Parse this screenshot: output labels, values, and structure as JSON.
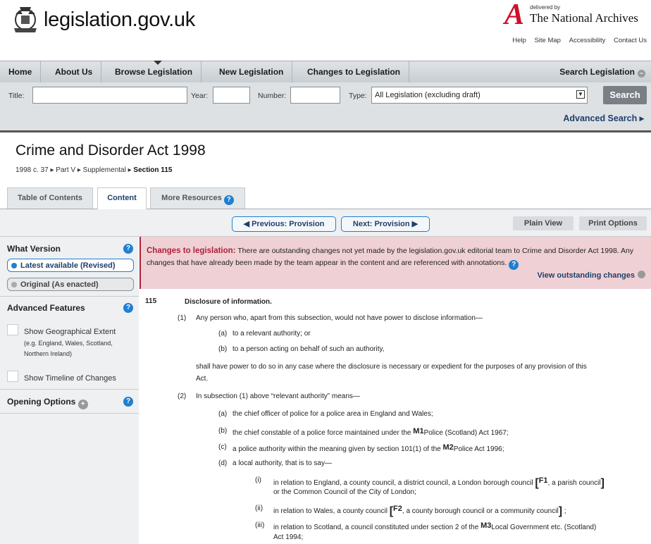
{
  "header": {
    "site_title": "legislation.gov.uk",
    "tna_delivered_by": "delivered by",
    "tna_name": "The National Archives",
    "top_links": [
      "Help",
      "Site Map",
      "Accessibility",
      "Contact Us"
    ]
  },
  "nav": {
    "items": [
      "Home",
      "About Us",
      "Browse Legislation",
      "New Legislation",
      "Changes to Legislation"
    ],
    "search_legislation": "Search Legislation"
  },
  "search": {
    "title_label": "Title:",
    "title_value": "",
    "year_label": "Year:",
    "year_value": "",
    "number_label": "Number:",
    "number_value": "",
    "type_label": "Type:",
    "type_value": "All Legislation (excluding draft)",
    "button": "Search",
    "advanced": "Advanced Search ▸"
  },
  "page": {
    "title": "Crime and Disorder Act 1998",
    "breadcrumb": [
      "1998 c. 37 ▸",
      "Part V ▸",
      "Supplemental ▸",
      "Section 115"
    ]
  },
  "tabs": [
    "Table of Contents",
    "Content",
    "More Resources"
  ],
  "provision_bar": {
    "previous": "◀ Previous: Provision",
    "next": "Next: Provision ▶",
    "plain_view": "Plain View",
    "print_options": "Print Options"
  },
  "sidebar": {
    "what_version": "What Version",
    "latest": "Latest available (Revised)",
    "original": "Original (As enacted)",
    "advanced_features": "Advanced Features",
    "show_geo": "Show Geographical Extent",
    "show_geo_sub": "(e.g. England, Wales, Scotland, Northern Ireland)",
    "show_timeline": "Show Timeline of Changes",
    "opening_options": "Opening Options"
  },
  "changes": {
    "label": "Changes to legislation:",
    "text": "There are outstanding changes not yet made by the legislation.gov.uk editorial team to Crime and Disorder Act 1998. Any changes that have already been made by the team appear in the content and are referenced with annotations.",
    "view_outstanding": "View outstanding changes"
  },
  "section": {
    "number": "115",
    "heading": "Disclosure of information.",
    "s1_num": "(1)",
    "s1_text": "Any person who, apart from this subsection, would not have power to disclose information—",
    "s1_a_num": "(a)",
    "s1_a": "to a relevant authority; or",
    "s1_b_num": "(b)",
    "s1_b": "to a person acting on behalf of such an authority,",
    "s1_tail_1": "shall have power to do so in any case where the disclosure is necessary or expedient for the purposes of any provision of this",
    "s1_tail_2": "Act.",
    "s2_num": "(2)",
    "s2_text": "In subsection (1) above “relevant authority” means—",
    "s2_a_num": "(a)",
    "s2_a": "the chief officer of police for a police area in England and Wales;",
    "s2_b_num": "(b)",
    "s2_b_pre": "the chief constable of a police force maintained under the",
    "s2_b_m": "M1",
    "s2_b_post": "Police (Scotland) Act 1967;",
    "s2_c_num": "(c)",
    "s2_c_pre": "a police authority within the meaning given by section 101(1) of the",
    "s2_c_m": "M2",
    "s2_c_post": "Police Act 1996;",
    "s2_d_num": "(d)",
    "s2_d": "a local authority, that is to say—",
    "i_num": "(i)",
    "i_pre": "in relation to England, a county council, a district council, a London borough council",
    "i_f": "F1",
    "i_post": ", a parish council",
    "i_line2": "or the Common Council of the City of London;",
    "ii_num": "(ii)",
    "ii_pre": "in relation to Wales, a county council",
    "ii_f": "F2",
    "ii_post": ", a county borough council or a community council",
    "ii_end": ";",
    "iii_num": "(iii)",
    "iii_pre": "in relation to Scotland, a council constituted under section 2 of the",
    "iii_m": "M3",
    "iii_post": "Local Government etc. (Scotland)",
    "iii_line2": "Act 1994;"
  }
}
